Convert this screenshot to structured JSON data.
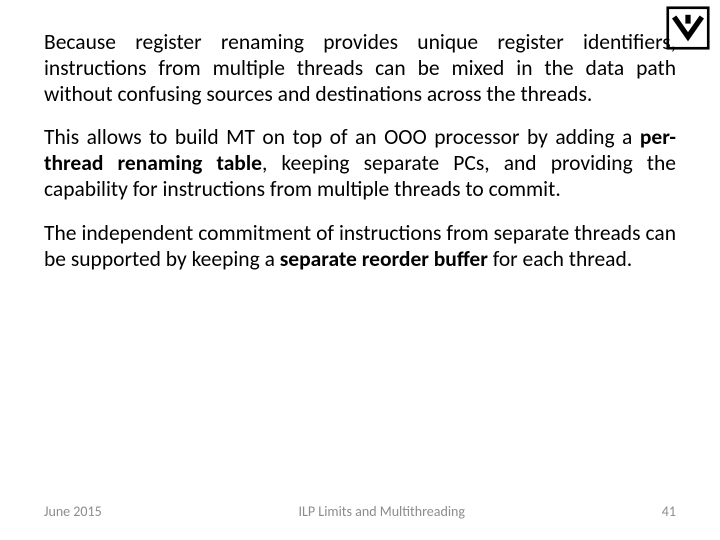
{
  "paragraphs": {
    "p1_a": "Because register renaming provides unique register identifiers, instructions from multiple threads can be mixed in the data path without confusing sources and destinations across the threads.",
    "p2_a": "This allows to build MT on top of an OOO processor by adding a ",
    "p2_b": "per-thread renaming table",
    "p2_c": ", keeping separate PCs, and providing the capability for instructions from multiple threads to commit.",
    "p3_a": "The independent commitment of instructions from separate threads can be supported by keeping a ",
    "p3_b": "separate reorder buffer",
    "p3_c": " for each thread."
  },
  "footer": {
    "date": "June 2015",
    "title": "ILP Limits and Multithreading",
    "page": "41"
  }
}
